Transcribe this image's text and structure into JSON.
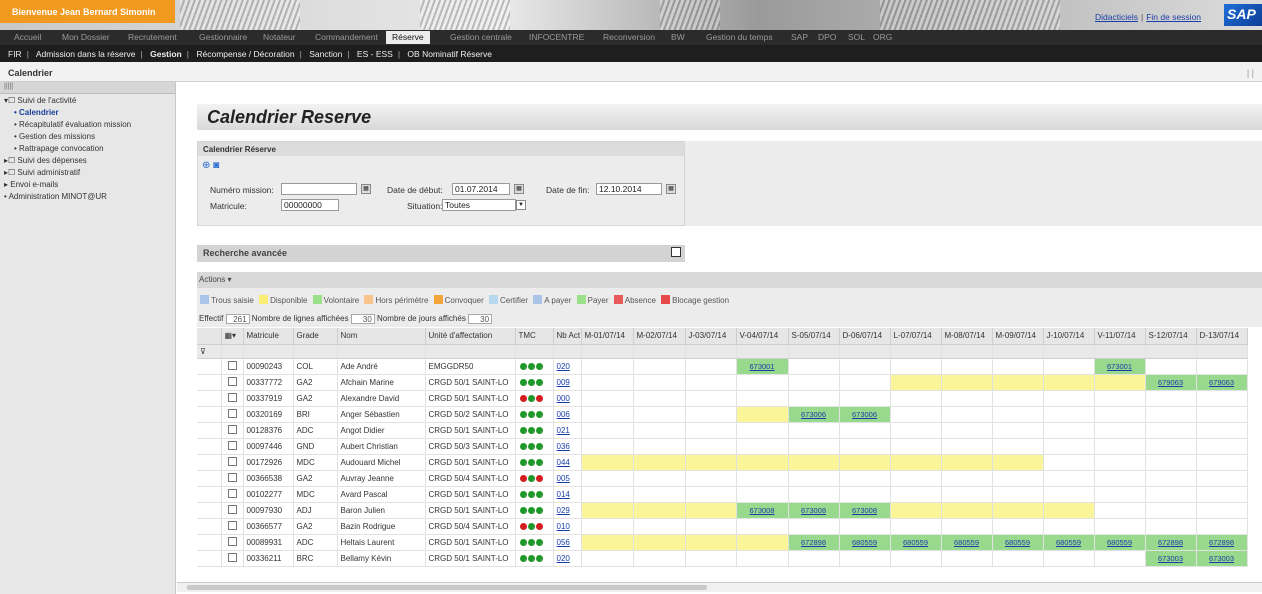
{
  "top": {
    "welcome": "Bienvenue Jean Bernard Simonin",
    "links": [
      "Didacticiels",
      "Fin de session"
    ],
    "logo": "SAP"
  },
  "menu": [
    "Accueil",
    "Mon Dossier",
    "Recrutement",
    "Gestionnaire",
    "Notateur",
    "Commandement",
    "Réserve",
    "Gestion centrale",
    "INFOCENTRE",
    "Reconversion",
    "BW",
    "Gestion du temps",
    "SAP",
    "DPO",
    "SOL",
    "ORG"
  ],
  "menu_active": "Réserve",
  "submenu": [
    "FIR",
    "Admission dans la réserve",
    "Gestion",
    "Récompense / Décoration",
    "Sanction",
    "ES - ESS",
    "OB Nominatif Réserve"
  ],
  "submenu_active": "Gestion",
  "page_title": "Calendrier",
  "sidebar": {
    "tools": "|||||",
    "items": [
      {
        "label": "Suivi de l'activité",
        "level": 1
      },
      {
        "label": "Calendrier",
        "level": 2,
        "selected": true
      },
      {
        "label": "Récapitulatif évaluation mission",
        "level": 2
      },
      {
        "label": "Gestion des missions",
        "level": 2
      },
      {
        "label": "Rattrapage convocation",
        "level": 2
      },
      {
        "label": "Suivi des dépenses",
        "level": 1
      },
      {
        "label": "Suivi administratif",
        "level": 1
      },
      {
        "label": "Envoi e-mails",
        "level": 1
      },
      {
        "label": "Administration MINOT@UR",
        "level": 1
      }
    ]
  },
  "main": {
    "heading": "Calendrier Reserve",
    "panel_title": "Calendrier Réserve",
    "labels": {
      "num_mission": "Numéro mission:",
      "matricule": "Matricule:",
      "date_debut": "Date de début:",
      "date_fin": "Date de fin:",
      "situation": "Situation:"
    },
    "values": {
      "num_mission": "",
      "matricule": "00000000",
      "date_debut": "01.07.2014",
      "date_fin": "12.10.2014",
      "situation": "Toutes"
    },
    "recherche": "Recherche avancée",
    "actions": "Actions",
    "legend": [
      {
        "label": "Trous saisie",
        "color": "#a9c4e6"
      },
      {
        "label": "Disponible",
        "color": "#f8ee74"
      },
      {
        "label": "Volontaire",
        "color": "#9be08b"
      },
      {
        "label": "Hors périmètre",
        "color": "#f8c48b"
      },
      {
        "label": "Convoquer",
        "color": "#f2a63a"
      },
      {
        "label": "Certifier",
        "color": "#b7d8ef"
      },
      {
        "label": "A payer",
        "color": "#a9c4e6"
      },
      {
        "label": "Payer",
        "color": "#9be08b"
      },
      {
        "label": "Absence",
        "color": "#e95a5a"
      },
      {
        "label": "Blocage gestion",
        "color": "#e84a4a"
      }
    ],
    "counts": {
      "effectif_label": "Effectif",
      "effectif": "261",
      "lignes_label": "Nombre de lignes affichées",
      "lignes": "30",
      "jours_label": "Nombre de jours affichés",
      "jours": "30"
    }
  },
  "table": {
    "columns": [
      "Matricule",
      "Grade",
      "Nom",
      "Unité d'affectation",
      "TMC",
      "Nb Act"
    ],
    "days": [
      "M-01/07/14",
      "M-02/07/14",
      "J-03/07/14",
      "V-04/07/14",
      "S-05/07/14",
      "D-06/07/14",
      "L-07/07/14",
      "M-08/07/14",
      "M-09/07/14",
      "J-10/07/14",
      "V-11/07/14",
      "S-12/07/14",
      "D-13/07/14"
    ],
    "rows": [
      {
        "mat": "00090243",
        "grade": "COL",
        "nom": "Ade André",
        "unite": "EMGGDR50",
        "tmc": [
          "g",
          "g",
          "g"
        ],
        "nb": "020",
        "cells": [
          "",
          "",
          "",
          {
            "t": "673001",
            "c": "g"
          },
          "",
          "",
          "",
          "",
          "",
          "",
          {
            "t": "673001",
            "c": "g"
          },
          "",
          ""
        ]
      },
      {
        "mat": "00337772",
        "grade": "GA2",
        "nom": "Afchain Marine",
        "unite": "CRGD 50/1 SAINT-LO",
        "tmc": [
          "g",
          "g",
          "g"
        ],
        "nb": "009",
        "cells": [
          "",
          "",
          "",
          "",
          "",
          "",
          {
            "c": "y"
          },
          {
            "c": "y"
          },
          {
            "c": "y"
          },
          {
            "c": "y"
          },
          {
            "c": "y"
          },
          {
            "t": "679063",
            "c": "g"
          },
          {
            "t": "679063",
            "c": "g"
          }
        ]
      },
      {
        "mat": "00337919",
        "grade": "GA2",
        "nom": "Alexandre David",
        "unite": "CRGD 50/1 SAINT-LO",
        "tmc": [
          "r",
          "g",
          "r"
        ],
        "nb": "000",
        "cells": [
          "",
          "",
          "",
          "",
          "",
          "",
          "",
          "",
          "",
          "",
          "",
          "",
          ""
        ]
      },
      {
        "mat": "00320169",
        "grade": "BRI",
        "nom": "Anger Sébastien",
        "unite": "CRGD 50/2 SAINT-LO",
        "tmc": [
          "g",
          "g",
          "g"
        ],
        "nb": "006",
        "cells": [
          "",
          "",
          "",
          {
            "c": "y"
          },
          {
            "t": "673006",
            "c": "g"
          },
          {
            "t": "673006",
            "c": "g"
          },
          "",
          "",
          "",
          "",
          "",
          "",
          ""
        ]
      },
      {
        "mat": "00128376",
        "grade": "ADC",
        "nom": "Angot Didier",
        "unite": "CRGD 50/1 SAINT-LO",
        "tmc": [
          "g",
          "g",
          "g"
        ],
        "nb": "021",
        "cells": [
          "",
          "",
          "",
          "",
          "",
          "",
          "",
          "",
          "",
          "",
          "",
          "",
          ""
        ]
      },
      {
        "mat": "00097446",
        "grade": "GND",
        "nom": "Aubert Christian",
        "unite": "CRGD 50/3 SAINT-LO",
        "tmc": [
          "g",
          "g",
          "g"
        ],
        "nb": "036",
        "cells": [
          "",
          "",
          "",
          "",
          "",
          "",
          "",
          "",
          "",
          "",
          "",
          "",
          ""
        ]
      },
      {
        "mat": "00172926",
        "grade": "MDC",
        "nom": "Audouard Michel",
        "unite": "CRGD 50/1 SAINT-LO",
        "tmc": [
          "g",
          "g",
          "g"
        ],
        "nb": "044",
        "cells": [
          {
            "c": "y"
          },
          {
            "c": "y"
          },
          {
            "c": "y"
          },
          {
            "c": "y"
          },
          {
            "c": "y"
          },
          {
            "c": "y"
          },
          {
            "c": "y"
          },
          {
            "c": "y"
          },
          {
            "c": "y"
          },
          "",
          "",
          "",
          ""
        ]
      },
      {
        "mat": "00366538",
        "grade": "GA2",
        "nom": "Auvray Jeanne",
        "unite": "CRGD 50/4 SAINT-LO",
        "tmc": [
          "r",
          "g",
          "r"
        ],
        "nb": "005",
        "cells": [
          "",
          "",
          "",
          "",
          "",
          "",
          "",
          "",
          "",
          "",
          "",
          "",
          ""
        ]
      },
      {
        "mat": "00102277",
        "grade": "MDC",
        "nom": "Avard Pascal",
        "unite": "CRGD 50/1 SAINT-LO",
        "tmc": [
          "g",
          "g",
          "g"
        ],
        "nb": "014",
        "cells": [
          "",
          "",
          "",
          "",
          "",
          "",
          "",
          "",
          "",
          "",
          "",
          "",
          ""
        ]
      },
      {
        "mat": "00097930",
        "grade": "ADJ",
        "nom": "Baron Julien",
        "unite": "CRGD 50/1 SAINT-LO",
        "tmc": [
          "g",
          "g",
          "g"
        ],
        "nb": "029",
        "cells": [
          {
            "c": "y"
          },
          {
            "c": "y"
          },
          {
            "c": "y"
          },
          {
            "t": "673008",
            "c": "g"
          },
          {
            "t": "673008",
            "c": "g"
          },
          {
            "t": "673008",
            "c": "g"
          },
          {
            "c": "y"
          },
          {
            "c": "y"
          },
          {
            "c": "y"
          },
          {
            "c": "y"
          },
          "",
          "",
          ""
        ]
      },
      {
        "mat": "00366577",
        "grade": "GA2",
        "nom": "Bazin Rodrigue",
        "unite": "CRGD 50/4 SAINT-LO",
        "tmc": [
          "r",
          "g",
          "r"
        ],
        "nb": "010",
        "cells": [
          "",
          "",
          "",
          "",
          "",
          "",
          "",
          "",
          "",
          "",
          "",
          "",
          ""
        ]
      },
      {
        "mat": "00089931",
        "grade": "ADC",
        "nom": "Heltais Laurent",
        "unite": "CRGD 50/1 SAINT-LO",
        "tmc": [
          "g",
          "g",
          "g"
        ],
        "nb": "056",
        "cells": [
          {
            "c": "y"
          },
          {
            "c": "y"
          },
          {
            "c": "y"
          },
          {
            "c": "y"
          },
          {
            "t": "672898",
            "c": "g"
          },
          {
            "t": "680559",
            "c": "g"
          },
          {
            "t": "680559",
            "c": "g"
          },
          {
            "t": "680559",
            "c": "g"
          },
          {
            "t": "680559",
            "c": "g"
          },
          {
            "t": "680559",
            "c": "g"
          },
          {
            "t": "680559",
            "c": "g"
          },
          {
            "t": "672898",
            "c": "g"
          },
          {
            "t": "672898",
            "c": "g"
          }
        ]
      },
      {
        "mat": "00336211",
        "grade": "BRC",
        "nom": "Bellamy Kévin",
        "unite": "CRGD 50/1 SAINT-LO",
        "tmc": [
          "g",
          "g",
          "g"
        ],
        "nb": "020",
        "cells": [
          "",
          "",
          "",
          "",
          "",
          "",
          "",
          "",
          "",
          "",
          "",
          {
            "t": "673003",
            "c": "g"
          },
          {
            "t": "673003",
            "c": "g"
          }
        ]
      }
    ]
  },
  "colors": {
    "accent": "#f29a1f",
    "link": "#1a3ea8",
    "dot_green": "#1f9a2a",
    "dot_red": "#d11d1d"
  }
}
